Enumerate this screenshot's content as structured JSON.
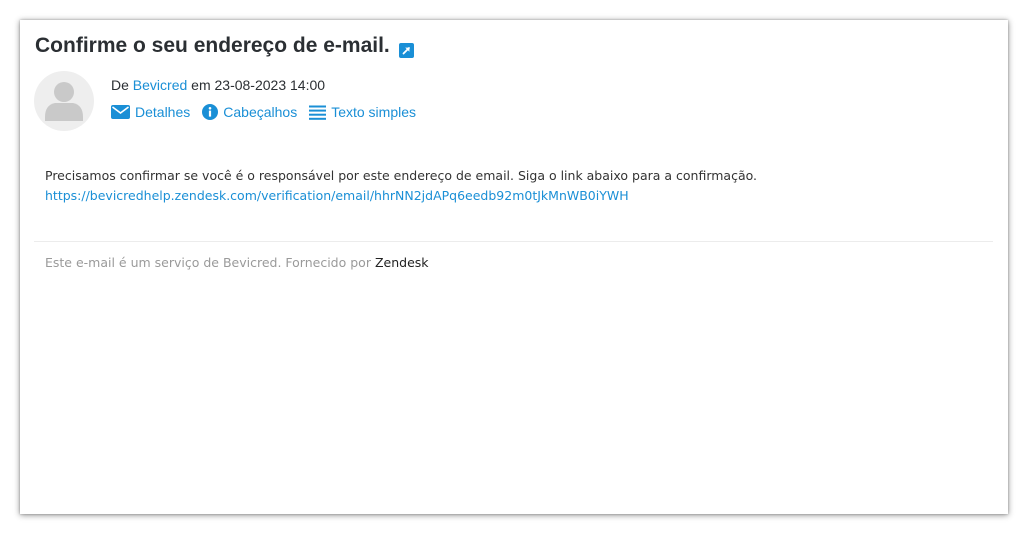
{
  "email": {
    "subject": "Confirme o seu endereço de e-mail.",
    "from_prefix": "De",
    "sender": "Bevicred",
    "date_prefix": "em",
    "datetime": "23-08-2023 14:00"
  },
  "actions": {
    "details": "Detalhes",
    "headers": "Cabeçalhos",
    "plain_text": "Texto simples"
  },
  "body": {
    "message": "Precisamos confirmar se você é o responsável por este endereço de email. Siga o link abaixo para a confirmação.",
    "link": "https://bevicredhelp.zendesk.com/verification/email/hhrNN2jdAPq6eedb92m0tJkMnWB0iYWH"
  },
  "footer": {
    "text": "Este e-mail é um serviço de Bevicred. Fornecido por",
    "brand": "Zendesk"
  },
  "colors": {
    "accent": "#1a8fd6",
    "text": "#2b2f33",
    "muted": "#9a9a9a"
  },
  "icons": {
    "popout": "external-link-icon",
    "avatar": "user-avatar-icon",
    "details": "envelope-icon",
    "headers": "info-icon",
    "plain_text": "list-icon"
  }
}
